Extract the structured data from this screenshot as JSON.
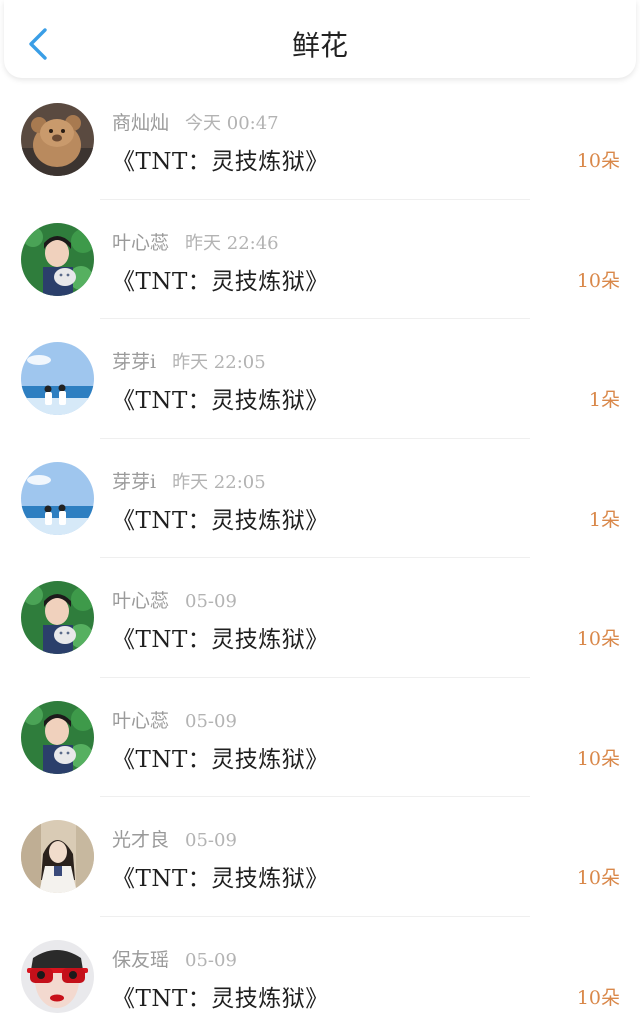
{
  "header": {
    "title": "鲜花",
    "back_icon": "chevron-left-icon",
    "accent": "#3a9ee6"
  },
  "colors": {
    "amount": "#d9884a",
    "meta": "#9a9a9a",
    "title": "#1f1f1f"
  },
  "items": [
    {
      "user": "商灿灿",
      "time": "今天 00:47",
      "book": "《TNT：灵技炼狱》",
      "amount": "10朵",
      "avatar": "teddy-bear-avatar"
    },
    {
      "user": "叶心蕊",
      "time": "昨天 22:46",
      "book": "《TNT：灵技炼狱》",
      "amount": "10朵",
      "avatar": "boy-with-cat-avatar"
    },
    {
      "user": "芽芽i",
      "time": "昨天 22:05",
      "book": "《TNT：灵技炼狱》",
      "amount": "1朵",
      "avatar": "seaside-couple-avatar"
    },
    {
      "user": "芽芽i",
      "time": "昨天 22:05",
      "book": "《TNT：灵技炼狱》",
      "amount": "1朵",
      "avatar": "seaside-couple-avatar"
    },
    {
      "user": "叶心蕊",
      "time": "05-09",
      "book": "《TNT：灵技炼狱》",
      "amount": "10朵",
      "avatar": "boy-with-cat-avatar"
    },
    {
      "user": "叶心蕊",
      "time": "05-09",
      "book": "《TNT：灵技炼狱》",
      "amount": "10朵",
      "avatar": "boy-with-cat-avatar"
    },
    {
      "user": "光才良",
      "time": "05-09",
      "book": "《TNT：灵技炼狱》",
      "amount": "10朵",
      "avatar": "girl-classroom-avatar"
    },
    {
      "user": "保友瑶",
      "time": "05-09",
      "book": "《TNT：灵技炼狱》",
      "amount": "10朵",
      "avatar": "red-sunglasses-avatar"
    }
  ]
}
